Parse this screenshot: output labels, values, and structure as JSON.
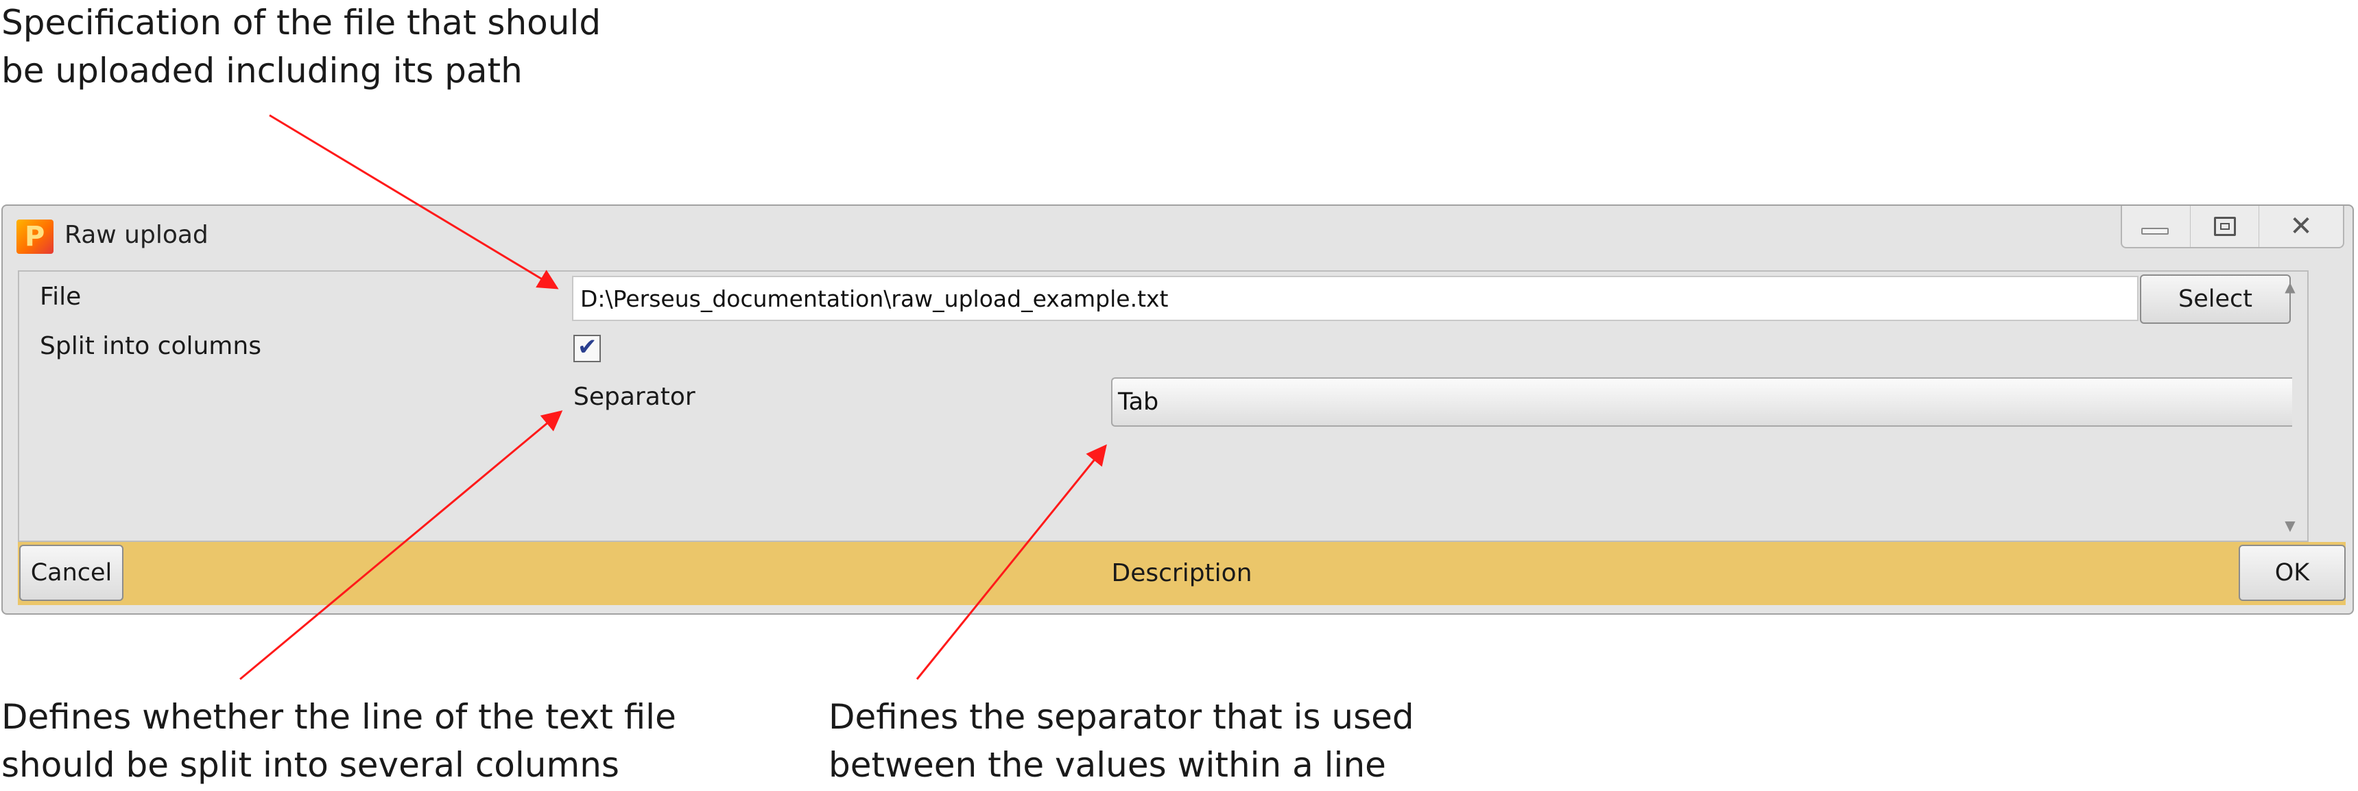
{
  "callouts": {
    "file": {
      "line1": "Specification of the file that should",
      "line2": "be uploaded including its path"
    },
    "split": {
      "line1": "Defines whether the line of the text file",
      "line2": "should be split into several columns"
    },
    "separator": {
      "line1": "Defines the separator that is used",
      "line2": "between the values within a line"
    }
  },
  "window": {
    "title": "Raw upload",
    "app_icon": "perseus-p-icon",
    "app_icon_letter": "P",
    "controls": [
      "minimize-icon",
      "maximize-icon",
      "close-icon"
    ],
    "close_glyph": "✕"
  },
  "form": {
    "file_label": "File",
    "file_value": "D:\\Perseus_documentation\\raw_upload_example.txt",
    "select_label": "Select",
    "split_label": "Split into columns",
    "split_checked": true,
    "checkmark": "✔",
    "separator_label": "Separator",
    "separator_value": "Tab"
  },
  "bottom_bar": {
    "cancel_label": "Cancel",
    "description_label": "Description",
    "ok_label": "OK"
  },
  "colors": {
    "arrow": "#ff1a1a",
    "description_bar": "#ebc66a",
    "checkmark": "#2a3f8f"
  }
}
